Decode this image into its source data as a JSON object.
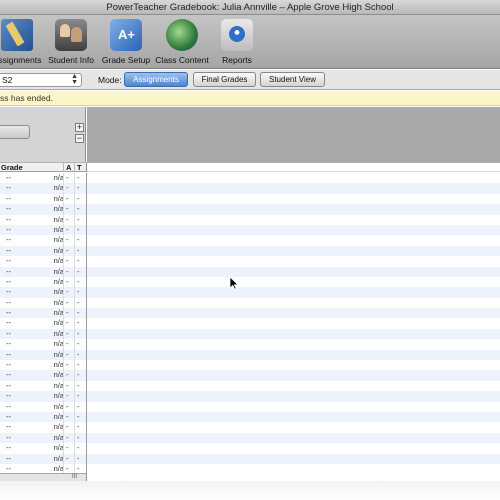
{
  "window": {
    "title": "PowerTeacher Gradebook: Julia Annville – Apple Grove High School"
  },
  "toolbar": {
    "buttons": [
      {
        "label": "Assignments",
        "icon": "pencil-book-icon"
      },
      {
        "label": "Student Info",
        "icon": "student-photos-icon"
      },
      {
        "label": "Grade Setup",
        "icon": "grade-setup-icon"
      },
      {
        "label": "Class Content",
        "icon": "globe-icon"
      },
      {
        "label": "Reports",
        "icon": "report-icon"
      }
    ]
  },
  "mode_bar": {
    "term_value": "S2",
    "mode_label": "Mode:",
    "modes": [
      {
        "label": "Assignments",
        "active": true
      },
      {
        "label": "Final Grades",
        "active": false
      },
      {
        "label": "Student View",
        "active": false
      }
    ],
    "active_color": "#5a8fd6"
  },
  "notice": {
    "text": "ss has ended."
  },
  "grade_panel": {
    "plus_label": "+",
    "minus_label": "−",
    "columns": {
      "grade": "Grade",
      "a": "A",
      "t": "T"
    },
    "row_template": {
      "letter": "--",
      "percent": "n/a",
      "a": "-",
      "t": "-"
    },
    "row_count": 29,
    "resize_grip": "III"
  }
}
